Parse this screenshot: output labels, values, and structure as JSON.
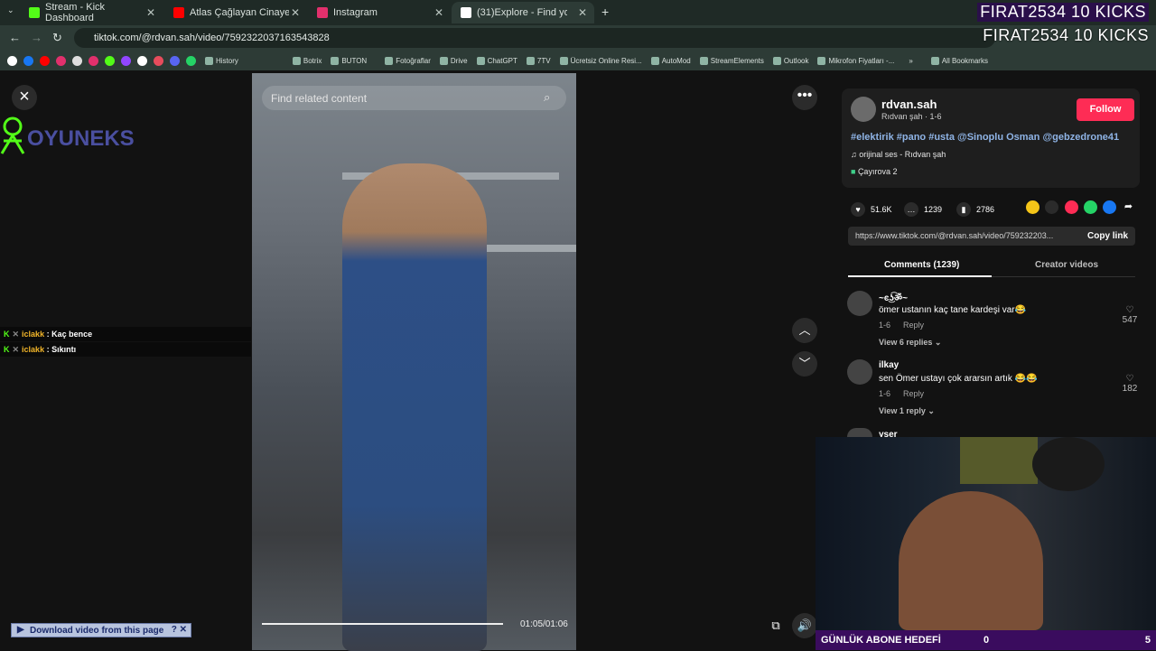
{
  "tabs": [
    {
      "title": "Stream - Kick Dashboard",
      "color": "#53fc18"
    },
    {
      "title": "Atlas Çağlayan Cinayetinde Tel",
      "color": "#ff0000"
    },
    {
      "title": "Instagram",
      "color": "#e1306c"
    },
    {
      "title": "(31)Explore - Find your fav",
      "color": "#ffffff"
    }
  ],
  "kicks": "FIRAT2534  10 KICKS",
  "address": {
    "url": "tiktok.com/@rdvan.sah/video/7592322037163543828"
  },
  "bookmarks": [
    "History",
    "Botrix",
    "BUTON",
    "Fotoğraflar",
    "Drive",
    "ChatGPT",
    "7TV",
    "Ücretsiz Online Resi...",
    "AutoMod",
    "StreamElements",
    "Outlook",
    "Mikrofon Fiyatları -..."
  ],
  "all_bookmarks": "All Bookmarks",
  "search": {
    "placeholder": "Find related content"
  },
  "logo_text": "OYUNEKS",
  "chat": [
    {
      "user": "iclakk",
      "msg": ": Kaç bence"
    },
    {
      "user": "iclakk",
      "msg": ": Sıkıntı"
    }
  ],
  "video": {
    "time": "01:05/01:06",
    "progress": 0.98
  },
  "download_label": "Download video from this page",
  "author": {
    "username": "rdvan.sah",
    "sub": "Rıdvan şah · 1-6",
    "follow": "Follow"
  },
  "caption": {
    "tags": "#elektirik #pano #usta @Sinoplu Osman @gebzedrone41",
    "sound": "orijinal ses - Rıdvan şah",
    "place": "Çayırova  2"
  },
  "stats": {
    "likes": "51.6K",
    "comments": "1239",
    "saves": "2786"
  },
  "link": {
    "url": "https://www.tiktok.com/@rdvan.sah/video/759232203...",
    "copy": "Copy link"
  },
  "comment_tabs": {
    "comments": "Comments (1239)",
    "creator": "Creator videos"
  },
  "comments": [
    {
      "user": "~ͼ͜ʖ͡ॐ~",
      "text": "ömer ustanın kaç tane kardeşi var😂",
      "date": "1-6",
      "reply": "Reply",
      "views": "View 6 replies ⌄",
      "likes": "547"
    },
    {
      "user": "ilkay",
      "text": "sen Ömer ustayı çok ararsın artık 😂😂",
      "date": "1-6",
      "reply": "Reply",
      "views": "View 1 reply ⌄",
      "likes": "182"
    },
    {
      "user": "yser",
      "text": "",
      "date": "",
      "reply": "",
      "views": "",
      "likes": ""
    }
  ],
  "goal": {
    "label": "GÜNLÜK ABONE HEDEFİ",
    "current": "0",
    "target": "5"
  }
}
